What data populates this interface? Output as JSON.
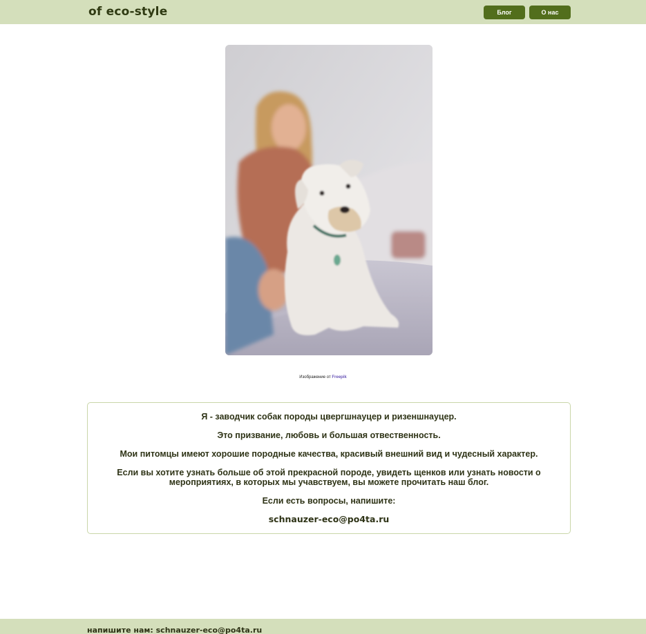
{
  "header": {
    "brand": "of eco-style",
    "nav": {
      "blog_label": "Блог",
      "about_label": "О нас"
    }
  },
  "hero": {
    "icon": "photo-woman-with-schnauzer",
    "credit_prefix": "Изображение от",
    "credit_link": "Freepik"
  },
  "about": {
    "paragraphs": [
      "Я - заводчик собак породы цвергшнауцер и ризеншнауцер.",
      "Это призвание, любовь и большая отвественность.",
      "Мои питомцы имеют хорошие породные качества, красивый внешний вид и чудесный характер.",
      "Если вы хотите узнать больше об этой прекрасной породе, увидеть щенков или узнать новости о мероприятиях, в которых мы учавствуем, вы можете прочитать наш блог.",
      "Если есть вопросы, напишите:"
    ],
    "email": "schnauzer-eco@po4ta.ru"
  },
  "footer": {
    "text": "напишите нам: schnauzer-eco@po4ta.ru"
  },
  "colors": {
    "bar_bg": "#d4dfbb",
    "button_bg": "#526e1c",
    "card_border": "#c9d6a8",
    "link": "#6b57b8"
  }
}
